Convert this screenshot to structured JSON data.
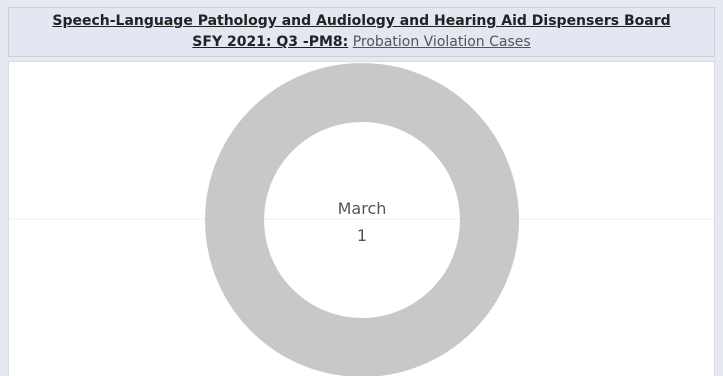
{
  "header": {
    "title": "Speech-Language Pathology and Audiology and Hearing Aid Dispensers Board",
    "subtitle_prefix": "SFY 2021: Q3 -PM8:",
    "subtitle_subject": "Probation Violation Cases"
  },
  "colors": {
    "ring": "#c8c8c8",
    "header_bg": "#e2e7f1",
    "gridline": "#ececec"
  },
  "chart_data": {
    "type": "pie",
    "variant": "donut",
    "categories": [
      "March"
    ],
    "values": [
      1
    ],
    "title": "",
    "center_label": "March",
    "center_value": "1"
  }
}
